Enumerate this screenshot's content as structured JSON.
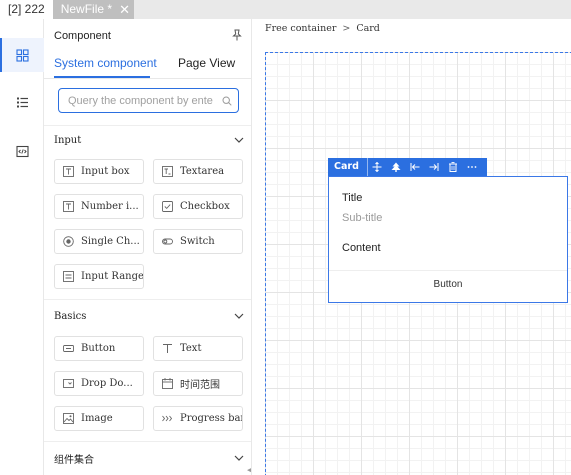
{
  "tabs": [
    {
      "label": "[2] 222"
    },
    {
      "label": "NewFile *"
    }
  ],
  "rail": [
    "components-grid-icon",
    "outline-list-icon",
    "code-icon"
  ],
  "panel": {
    "title": "Component",
    "tab_system": "System component",
    "tab_page": "Page View",
    "search_placeholder": "Query the component by ente",
    "sections": [
      {
        "title": "Input",
        "items": [
          {
            "label": "Input box",
            "icon": "input-box-icon"
          },
          {
            "label": "Textarea",
            "icon": "textarea-icon"
          },
          {
            "label": "Number i...",
            "icon": "number-input-icon"
          },
          {
            "label": "Checkbox",
            "icon": "checkbox-icon"
          },
          {
            "label": "Single Ch...",
            "icon": "radio-icon"
          },
          {
            "label": "Switch",
            "icon": "switch-icon"
          },
          {
            "label": "Input Range",
            "icon": "input-range-icon"
          }
        ]
      },
      {
        "title": "Basics",
        "items": [
          {
            "label": "Button",
            "icon": "button-icon"
          },
          {
            "label": "Text",
            "icon": "text-icon"
          },
          {
            "label": "Drop Do...",
            "icon": "dropdown-icon"
          },
          {
            "label": "时间范围",
            "icon": "calendar-icon"
          },
          {
            "label": "Image",
            "icon": "image-icon"
          },
          {
            "label": "Progress bar",
            "icon": "progress-icon"
          }
        ]
      },
      {
        "title": "组件集合",
        "items": []
      }
    ]
  },
  "breadcrumb": {
    "root": "Free container",
    "separator": ">",
    "current": "Card"
  },
  "card": {
    "toolbar_label": "Card",
    "title": "Title",
    "subtitle": "Sub-title",
    "content": "Content",
    "button": "Button"
  },
  "colors": {
    "accent": "#2b6fe0",
    "tab_inactive": "#bfbfbf"
  }
}
